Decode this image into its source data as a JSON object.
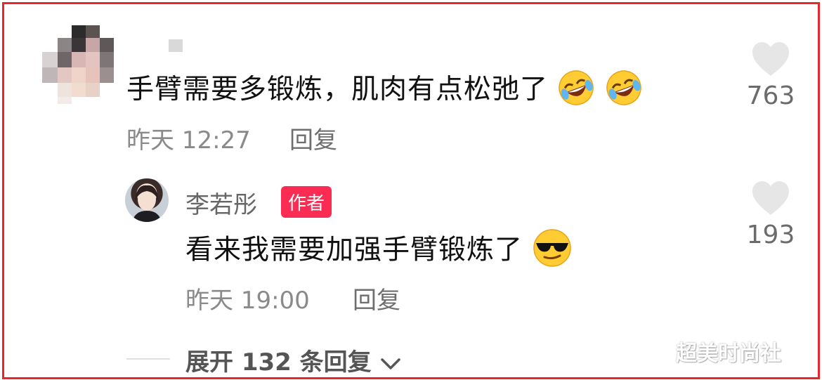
{
  "comment": {
    "text": "手臂需要多锻炼，肌肉有点松弛了",
    "emojis": [
      "rolling-laughing-emoji",
      "rolling-laughing-emoji"
    ],
    "time": "昨天 12:27",
    "reply_label": "回复",
    "likes": "763"
  },
  "reply": {
    "username": "李若彤",
    "badge": "作者",
    "text": "看来我需要加强手臂锻炼了",
    "emoji": "sunglasses-emoji",
    "time": "昨天 19:00",
    "reply_label": "回复",
    "likes": "193"
  },
  "expand": {
    "label": "展开 132 条回复"
  },
  "watermark": "超美时尚社",
  "colors": {
    "frame": "#e8262c",
    "badge": "#fb2c53",
    "heart": "#e6e6e6"
  }
}
